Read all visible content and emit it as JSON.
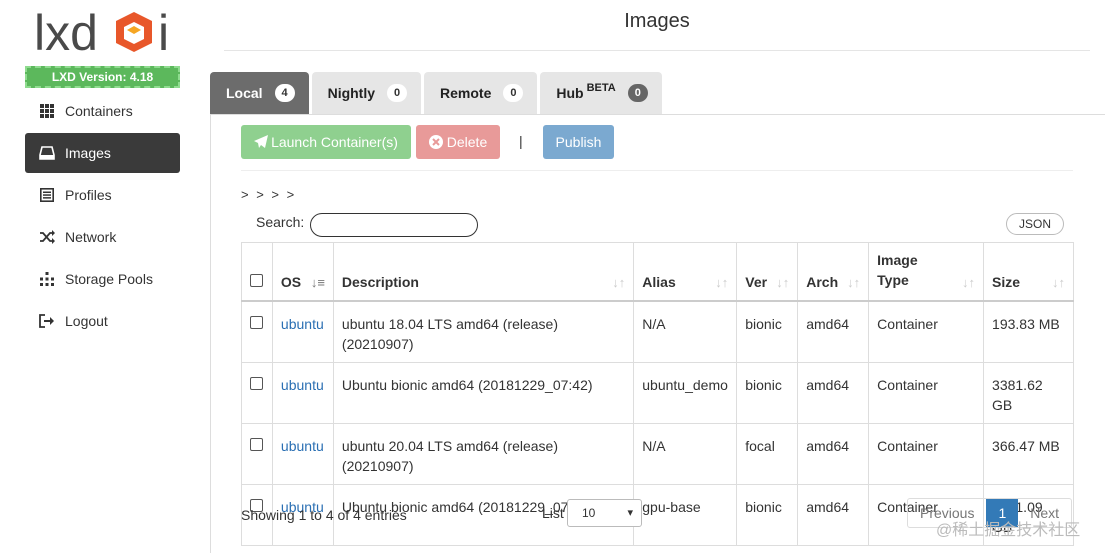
{
  "sidebar": {
    "logo_text": "lxdui",
    "version": "LXD Version: 4.18",
    "items": [
      {
        "label": "Containers",
        "icon": "grid-icon",
        "active": false
      },
      {
        "label": "Images",
        "icon": "drive-icon",
        "active": true
      },
      {
        "label": "Profiles",
        "icon": "list-icon",
        "active": false
      },
      {
        "label": "Network",
        "icon": "shuffle-icon",
        "active": false
      },
      {
        "label": "Storage Pools",
        "icon": "dots-grid-icon",
        "active": false
      },
      {
        "label": "Logout",
        "icon": "logout-icon",
        "active": false
      }
    ]
  },
  "header": {
    "title": "Images"
  },
  "tabs": [
    {
      "label": "Local",
      "count": "4",
      "active": true
    },
    {
      "label": "Nightly",
      "count": "0"
    },
    {
      "label": "Remote",
      "count": "0"
    },
    {
      "label": "Hub",
      "sup": "BETA",
      "count": "0"
    }
  ],
  "toolbar": {
    "launch_label": "Launch Container(s)",
    "delete_label": "Delete",
    "separator": "|",
    "publish_label": "Publish"
  },
  "breadcrumb": "> > > >",
  "search": {
    "label": "Search:",
    "value": ""
  },
  "json_label": "JSON",
  "table": {
    "columns": [
      "OS",
      "Description",
      "Alias",
      "Ver",
      "Arch",
      "Image Type",
      "Size"
    ],
    "rows": [
      {
        "os": "ubuntu",
        "desc": "ubuntu 18.04 LTS amd64 (release) (20210907)",
        "alias": "N/A",
        "ver": "bionic",
        "arch": "amd64",
        "type": "Container",
        "size": "193.83 MB"
      },
      {
        "os": "ubuntu",
        "desc": "Ubuntu bionic amd64 (20181229_07:42)",
        "alias": "ubuntu_demo",
        "ver": "bionic",
        "arch": "amd64",
        "type": "Container",
        "size": "3381.62 GB"
      },
      {
        "os": "ubuntu",
        "desc": "ubuntu 20.04 LTS amd64 (release) (20210907)",
        "alias": "N/A",
        "ver": "focal",
        "arch": "amd64",
        "type": "Container",
        "size": "366.47 MB"
      },
      {
        "os": "ubuntu",
        "desc": "Ubuntu bionic amd64 (20181229_07:42)",
        "alias": "gpu-base",
        "ver": "bionic",
        "arch": "amd64",
        "type": "Container",
        "size": "5821.09 GB"
      }
    ]
  },
  "footer": {
    "info": "Showing 1 to 4 of 4 entries",
    "list_label": "List",
    "list_value": "10",
    "prev_label": "Previous",
    "page": "1",
    "next_label": "Next",
    "watermark": "@稀土掘金技术社区"
  }
}
